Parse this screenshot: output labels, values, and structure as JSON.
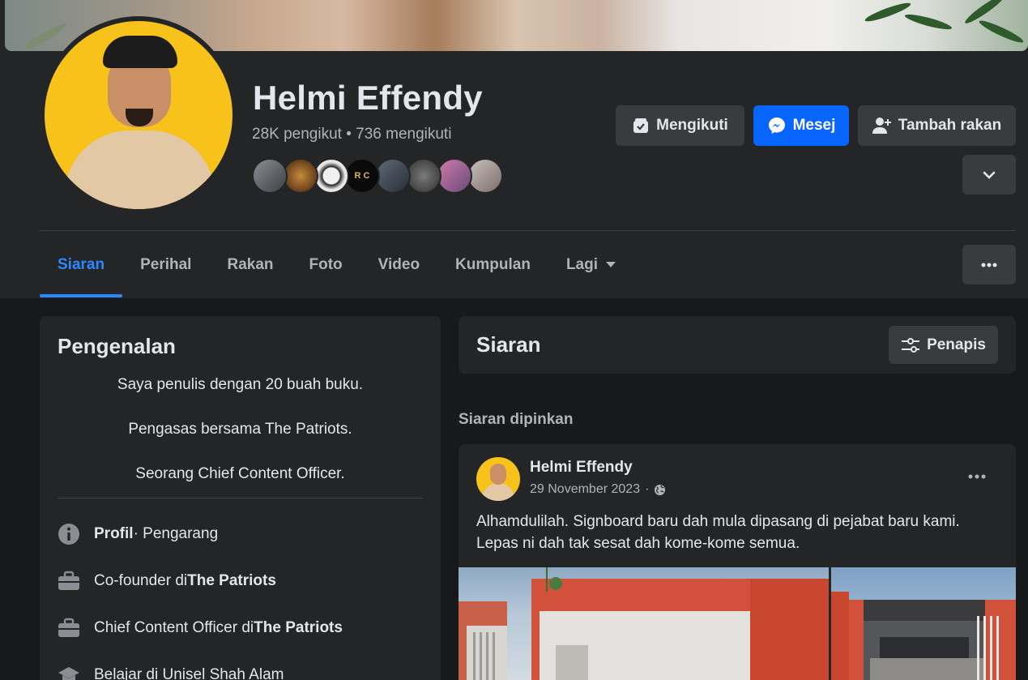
{
  "profile": {
    "name": "Helmi Effendy",
    "followers": "28K pengikut",
    "separator": "•",
    "following": "736 mengikuti"
  },
  "actions": {
    "following_label": "Mengikuti",
    "message_label": "Mesej",
    "add_friend_label": "Tambah rakan"
  },
  "tabs": [
    {
      "label": "Siaran",
      "active": true
    },
    {
      "label": "Perihal"
    },
    {
      "label": "Rakan"
    },
    {
      "label": "Foto"
    },
    {
      "label": "Video"
    },
    {
      "label": "Kumpulan"
    },
    {
      "label": "Lagi"
    }
  ],
  "intro": {
    "title": "Pengenalan",
    "bio": [
      "Saya penulis dengan 20 buah buku.",
      "Pengasas bersama The Patriots.",
      "Seorang Chief Content Officer."
    ],
    "details": [
      {
        "icon": "info-icon",
        "bold": "Profil",
        "text": " · Pengarang"
      },
      {
        "icon": "briefcase-icon",
        "text": "Co-founder di ",
        "bold": "The Patriots"
      },
      {
        "icon": "briefcase-icon",
        "text": "Chief Content Officer di ",
        "bold": "The Patriots"
      },
      {
        "icon": "graduation-cap-icon",
        "text": "Belajar di Unisel Shah Alam"
      }
    ]
  },
  "posts_section": {
    "title": "Siaran",
    "filter_label": "Penapis",
    "pinned_label": "Siaran dipinkan"
  },
  "post": {
    "author": "Helmi Effendy",
    "date": "29 November 2023",
    "separator": "·",
    "text": "Alhamdulilah. Signboard baru dah mula dipasang di pejabat baru kami. Lepas ni dah tak sesat dah kome-kome semua."
  },
  "icons": {
    "following": "following-icon",
    "messenger": "messenger-icon",
    "add_friend": "add-friend-icon",
    "chevron": "chevron-down-icon",
    "more": "more-horizontal-icon",
    "filter": "filter-icon",
    "globe": "globe-icon"
  },
  "colors": {
    "accent": "#0866ff",
    "tab_active": "#2d88ff",
    "background": "#18191a",
    "surface": "#242526",
    "button": "#3a3b3c",
    "avatar_bg": "#f7c219"
  }
}
